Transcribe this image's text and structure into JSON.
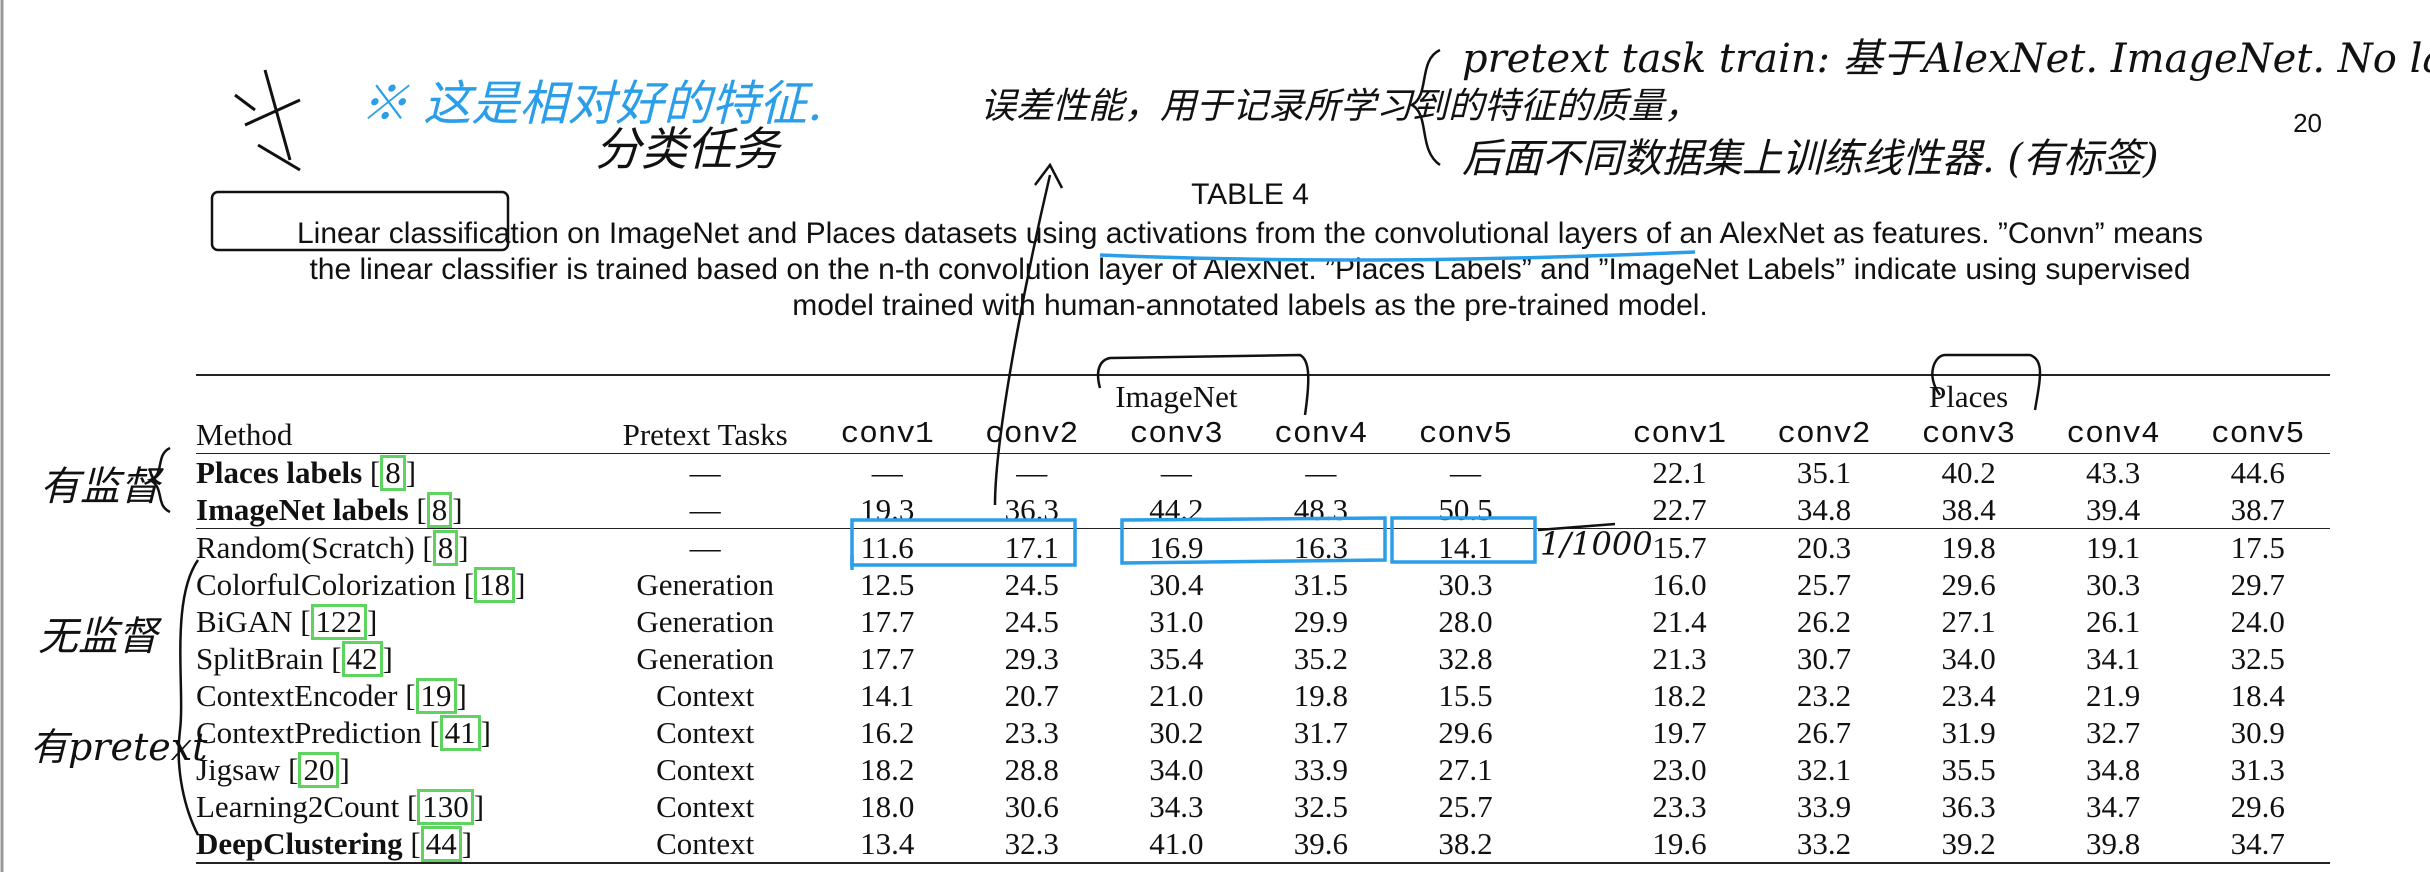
{
  "page_number": "20",
  "table_label": "TABLE 4",
  "caption": {
    "line1": "Linear classification on ImageNet and Places datasets using activations from the convolutional layers of an AlexNet as features. ”Convn” means",
    "line2": "the linear classifier is trained based on the n-th convolution layer of AlexNet. ”Places Labels” and ”ImageNet Labels” indicate using supervised",
    "line3": "model trained with human-annotated labels as the pre-trained model."
  },
  "table": {
    "group_headers": {
      "imagenet": "ImageNet",
      "places": "Places"
    },
    "columns": {
      "method": "Method",
      "pretext": "Pretext Tasks",
      "imagenet": [
        "conv1",
        "conv2",
        "conv3",
        "conv4",
        "conv5"
      ],
      "places": [
        "conv1",
        "conv2",
        "conv3",
        "conv4",
        "conv5"
      ]
    },
    "rows": [
      {
        "name": "Places labels",
        "cite": "8",
        "pretext": "—",
        "imagenet": [
          "—",
          "—",
          "—",
          "—",
          "—"
        ],
        "places": [
          "22.1",
          "35.1",
          "40.2",
          "43.3",
          "44.6"
        ]
      },
      {
        "name": "ImageNet labels",
        "cite": "8",
        "pretext": "—",
        "imagenet": [
          "19.3",
          "36.3",
          "44.2",
          "48.3",
          "50.5"
        ],
        "places": [
          "22.7",
          "34.8",
          "38.4",
          "39.4",
          "38.7"
        ]
      },
      {
        "name": "Random(Scratch)",
        "cite": "8",
        "pretext": "—",
        "imagenet": [
          "11.6",
          "17.1",
          "16.9",
          "16.3",
          "14.1"
        ],
        "places": [
          "15.7",
          "20.3",
          "19.8",
          "19.1",
          "17.5"
        ]
      },
      {
        "name": "ColorfulColorization",
        "cite": "18",
        "pretext": "Generation",
        "imagenet": [
          "12.5",
          "24.5",
          "30.4",
          "31.5",
          "30.3"
        ],
        "places": [
          "16.0",
          "25.7",
          "29.6",
          "30.3",
          "29.7"
        ]
      },
      {
        "name": "BiGAN",
        "cite": "122",
        "pretext": "Generation",
        "imagenet": [
          "17.7",
          "24.5",
          "31.0",
          "29.9",
          "28.0"
        ],
        "places": [
          "21.4",
          "26.2",
          "27.1",
          "26.1",
          "24.0"
        ]
      },
      {
        "name": "SplitBrain",
        "cite": "42",
        "pretext": "Generation",
        "imagenet": [
          "17.7",
          "29.3",
          "35.4",
          "35.2",
          "32.8"
        ],
        "places": [
          "21.3",
          "30.7",
          "34.0",
          "34.1",
          "32.5"
        ]
      },
      {
        "name": "ContextEncoder",
        "cite": "19",
        "pretext": "Context",
        "imagenet": [
          "14.1",
          "20.7",
          "21.0",
          "19.8",
          "15.5"
        ],
        "places": [
          "18.2",
          "23.2",
          "23.4",
          "21.9",
          "18.4"
        ]
      },
      {
        "name": "ContextPrediction",
        "cite": "41",
        "pretext": "Context",
        "imagenet": [
          "16.2",
          "23.3",
          "30.2",
          "31.7",
          "29.6"
        ],
        "places": [
          "19.7",
          "26.7",
          "31.9",
          "32.7",
          "30.9"
        ]
      },
      {
        "name": "Jigsaw",
        "cite": "20",
        "pretext": "Context",
        "imagenet": [
          "18.2",
          "28.8",
          "34.0",
          "33.9",
          "27.1"
        ],
        "places": [
          "23.0",
          "32.1",
          "35.5",
          "34.8",
          "31.3"
        ]
      },
      {
        "name": "Learning2Count",
        "cite": "130",
        "pretext": "Context",
        "imagenet": [
          "18.0",
          "30.6",
          "34.3",
          "32.5",
          "25.7"
        ],
        "places": [
          "23.3",
          "33.9",
          "36.3",
          "34.7",
          "29.6"
        ]
      },
      {
        "name": "DeepClustering",
        "cite": "44",
        "pretext": "Context",
        "imagenet": [
          "13.4",
          "32.3",
          "41.0",
          "39.6",
          "38.2"
        ],
        "places": [
          "19.6",
          "33.2",
          "39.2",
          "39.8",
          "34.7"
        ]
      }
    ]
  },
  "annotations": {
    "handwritten_1": "※ 这是相对好的特征.",
    "handwritten_2": "分类任务",
    "handwritten_3": "误差性能，用于记录所学习到的特征的质量，",
    "handwritten_4": "pretext task train: 基于AlexNet. ImageNet. No label,",
    "handwritten_5": "后面不同数据集上训练线性器. (有标签)",
    "handwritten_6": "有监督",
    "handwritten_7": "无监督",
    "handwritten_8": "有pretext",
    "handwritten_9": "1/1000"
  }
}
